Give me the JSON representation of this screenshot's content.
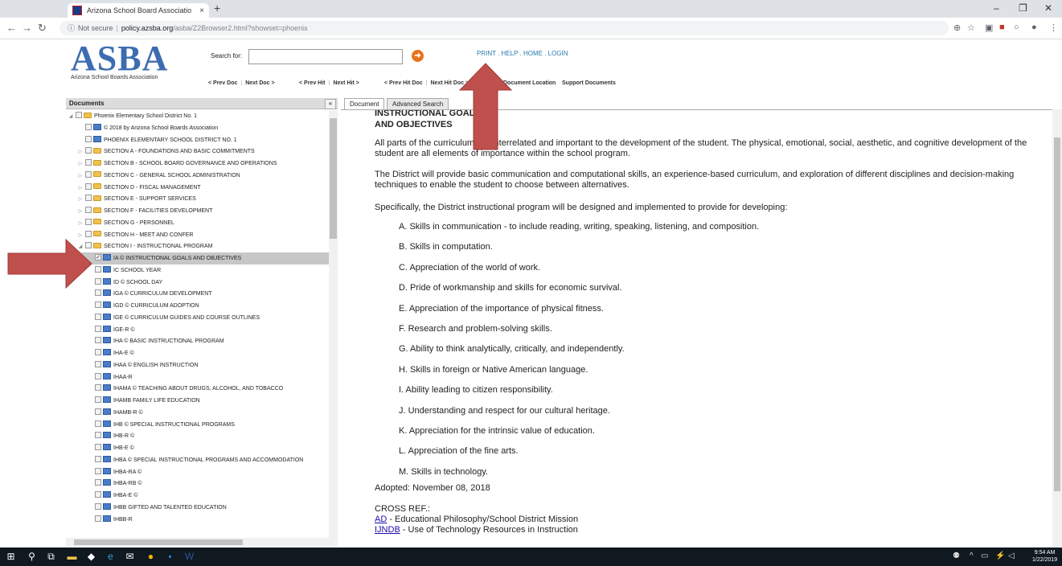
{
  "browser": {
    "tab_title": "Arizona School Board Associatio",
    "tab_close": "×",
    "new_tab": "+",
    "window_controls": [
      "–",
      "❐",
      "✕"
    ],
    "url_security": "Not secure",
    "url_host": "policy.azsba.org",
    "url_path": "/asba/Z2Browser2.html?showset=phoenix"
  },
  "header": {
    "logo_text": "ASBA",
    "logo_subtitle": "Arizona School Boards Association",
    "search_label": "Search for:",
    "search_value": "",
    "top_links": [
      "PRINT",
      "HELP",
      "HOME",
      "LOGIN"
    ],
    "doc_nav": [
      "< Prev Doc",
      "Next Doc >",
      "< Prev Hit",
      "Next Hit >",
      "< Prev Hit Doc",
      "Next Hit Doc >",
      "Document Location",
      "Support Documents"
    ]
  },
  "left_panel": {
    "title": "Documents",
    "collapse": "«"
  },
  "tree": [
    {
      "label": "Phoenix Elementary School District No. 1",
      "indent": 0,
      "type": "folder",
      "expand": "open"
    },
    {
      "label": "© 2018 by Arizona School Boards Association",
      "indent": 1,
      "type": "doc",
      "expand": "none"
    },
    {
      "label": "PHOENIX ELEMENTARY SCHOOL DISTRICT NO. 1",
      "indent": 1,
      "type": "doc",
      "expand": "none"
    },
    {
      "label": "SECTION A - FOUNDATIONS AND BASIC COMMITMENTS",
      "indent": 1,
      "type": "folder",
      "expand": "closed"
    },
    {
      "label": "SECTION B - SCHOOL BOARD GOVERNANCE AND OPERATIONS",
      "indent": 1,
      "type": "folder",
      "expand": "closed"
    },
    {
      "label": "SECTION C - GENERAL SCHOOL ADMINISTRATION",
      "indent": 1,
      "type": "folder",
      "expand": "closed"
    },
    {
      "label": "SECTION D - FISCAL MANAGEMENT",
      "indent": 1,
      "type": "folder",
      "expand": "closed"
    },
    {
      "label": "SECTION E - SUPPORT SERVICES",
      "indent": 1,
      "type": "folder",
      "expand": "closed"
    },
    {
      "label": "SECTION F - FACILITIES DEVELOPMENT",
      "indent": 1,
      "type": "folder",
      "expand": "closed"
    },
    {
      "label": "SECTION G - PERSONNEL",
      "indent": 1,
      "type": "folder",
      "expand": "closed"
    },
    {
      "label": "SECTION H - MEET AND CONFER",
      "indent": 1,
      "type": "folder",
      "expand": "closed"
    },
    {
      "label": "SECTION I - INSTRUCTIONAL PROGRAM",
      "indent": 1,
      "type": "folder",
      "expand": "open"
    },
    {
      "label": "IA © INSTRUCTIONAL GOALS AND OBJECTIVES",
      "indent": 2,
      "type": "doc",
      "expand": "none",
      "selected": true,
      "checked": true
    },
    {
      "label": "IC SCHOOL YEAR",
      "indent": 2,
      "type": "doc",
      "expand": "none"
    },
    {
      "label": "ID © SCHOOL DAY",
      "indent": 2,
      "type": "doc",
      "expand": "none"
    },
    {
      "label": "IGA © CURRICULUM DEVELOPMENT",
      "indent": 2,
      "type": "doc",
      "expand": "none"
    },
    {
      "label": "IGD © CURRICULUM ADOPTION",
      "indent": 2,
      "type": "doc",
      "expand": "none"
    },
    {
      "label": "IGE © CURRICULUM GUIDES AND COURSE OUTLINES",
      "indent": 2,
      "type": "doc",
      "expand": "none"
    },
    {
      "label": "IGE-R ©",
      "indent": 2,
      "type": "doc",
      "expand": "none"
    },
    {
      "label": "IHA © BASIC INSTRUCTIONAL PROGRAM",
      "indent": 2,
      "type": "doc",
      "expand": "none"
    },
    {
      "label": "IHA-E ©",
      "indent": 2,
      "type": "doc",
      "expand": "none"
    },
    {
      "label": "IHAA © ENGLISH INSTRUCTION",
      "indent": 2,
      "type": "doc",
      "expand": "none"
    },
    {
      "label": "IHAA-R",
      "indent": 2,
      "type": "doc",
      "expand": "none"
    },
    {
      "label": "IHAMA © TEACHING ABOUT DRUGS, ALCOHOL, AND TOBACCO",
      "indent": 2,
      "type": "doc",
      "expand": "none"
    },
    {
      "label": "IHAMB FAMILY LIFE EDUCATION",
      "indent": 2,
      "type": "doc",
      "expand": "none"
    },
    {
      "label": "IHAMB-R ©",
      "indent": 2,
      "type": "doc",
      "expand": "none"
    },
    {
      "label": "IHB © SPECIAL INSTRUCTIONAL PROGRAMS",
      "indent": 2,
      "type": "doc",
      "expand": "none"
    },
    {
      "label": "IHB-R ©",
      "indent": 2,
      "type": "doc",
      "expand": "none"
    },
    {
      "label": "IHB-E ©",
      "indent": 2,
      "type": "doc",
      "expand": "none"
    },
    {
      "label": "IHBA © SPECIAL INSTRUCTIONAL PROGRAMS AND ACCOMMODATION",
      "indent": 2,
      "type": "doc",
      "expand": "none"
    },
    {
      "label": "IHBA-RA ©",
      "indent": 2,
      "type": "doc",
      "expand": "none"
    },
    {
      "label": "IHBA-RB ©",
      "indent": 2,
      "type": "doc",
      "expand": "none"
    },
    {
      "label": "IHBA-E ©",
      "indent": 2,
      "type": "doc",
      "expand": "none"
    },
    {
      "label": "IHBB GIFTED AND TALENTED EDUCATION",
      "indent": 2,
      "type": "doc",
      "expand": "none"
    },
    {
      "label": "IHBB-R",
      "indent": 2,
      "type": "doc",
      "expand": "none"
    }
  ],
  "doc_tabs": [
    "Document",
    "Advanced Search"
  ],
  "document": {
    "title_line1": "INSTRUCTIONAL GOALS",
    "title_line2": "AND OBJECTIVES",
    "para1": "All parts of the curriculum are interrelated and important to the development of the student.  The physical, emotional, social, aesthetic, and cognitive development of the student are all elements of importance within the school program.",
    "para2": "The District will provide basic communication and computational skills, an experience-based curriculum, and exploration of different disciplines and decision-making techniques to enable the student to choose between alternatives.",
    "para3": "Specifically, the District instructional program will be designed and implemented to provide for developing:",
    "list": [
      "A.  Skills in communication - to include reading, writing, speaking, listening, and composition.",
      "B.  Skills in computation.",
      "C.  Appreciation of the world of work.",
      "D.  Pride of workmanship and skills for economic survival.",
      "E.  Appreciation of the importance of physical fitness.",
      "F.  Research and problem-solving skills.",
      "G.  Ability to think analytically, critically, and independently.",
      "H.  Skills in foreign or Native American language.",
      "I.   Ability leading to citizen responsibility.",
      "J.   Understanding and respect for our cultural heritage.",
      "K.  Appreciation for the intrinsic value of education.",
      "L.  Appreciation of the fine arts.",
      "M. Skills in technology."
    ],
    "adopted": "Adopted:  November 08, 2018",
    "cross_ref_title": "CROSS REF.:",
    "cross_refs": [
      {
        "code": "AD",
        "text": " - Educational Philosophy/School District Mission"
      },
      {
        "code": "IJNDB",
        "text": " - Use of Technology Resources in Instruction"
      }
    ]
  },
  "taskbar": {
    "time": "9:54 AM",
    "date": "1/22/2019"
  },
  "colors": {
    "arrow": "#c0504d",
    "logo": "#3d6db0",
    "links": "#2a7ab0",
    "go_button": "#e8731b"
  }
}
